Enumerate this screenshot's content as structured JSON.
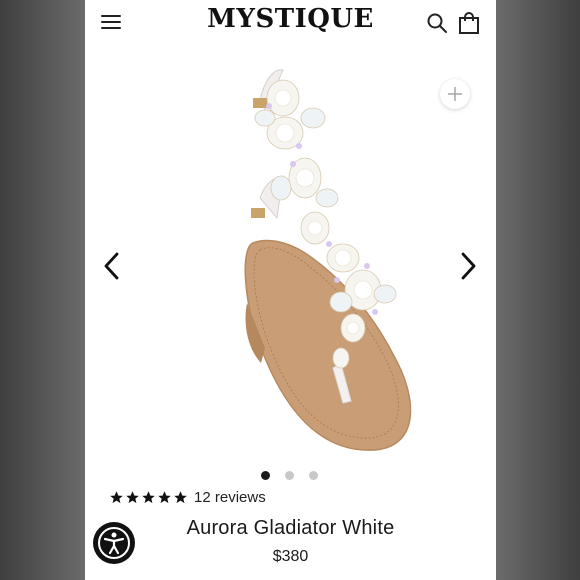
{
  "brand": {
    "name": "MYSTIQUE"
  },
  "header": {
    "menu_icon": "hamburger-menu-icon",
    "search_icon": "search-icon",
    "bag_icon": "shopping-bag-icon"
  },
  "gallery": {
    "zoom_icon": "plus-icon",
    "prev_icon": "chevron-left-icon",
    "next_icon": "chevron-right-icon",
    "image_alt": "sandal-product-image",
    "slides_total": 3,
    "active_slide": 1
  },
  "product": {
    "rating": 5,
    "reviews_label": "12 reviews",
    "title": "Aurora Gladiator White",
    "price": "$380"
  },
  "accessibility": {
    "icon": "accessibility-icon"
  },
  "colors": {
    "text": "#1a1a1a",
    "dot_active": "#1a1a1a",
    "dot_inactive": "#c8c8c8",
    "background_frame": "#5b5b5b"
  }
}
